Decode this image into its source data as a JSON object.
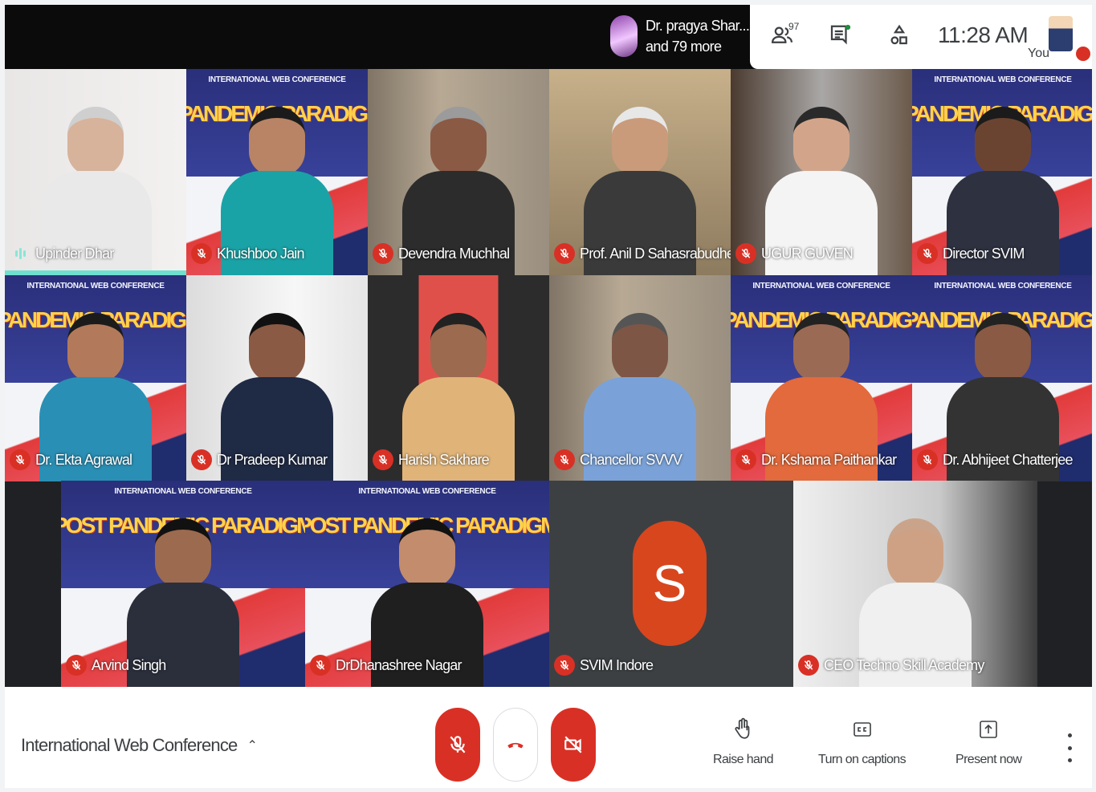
{
  "topbar": {
    "presenter_line1": "Dr. pragya Shar...",
    "presenter_line2": "and 79 more",
    "people_count": "97",
    "clock": "11:28 AM",
    "you_label": "You"
  },
  "tiles": [
    {
      "name": "Upinder Dhar",
      "state": "speaking",
      "icon": "audio-wave-icon"
    },
    {
      "name": "Khushboo Jain",
      "state": "muted",
      "icon": "mic-off-icon"
    },
    {
      "name": "Devendra Muchhal",
      "state": "muted",
      "icon": "mic-off-icon"
    },
    {
      "name": "Prof. Anil D Sahasrabudhe",
      "state": "muted",
      "icon": "mic-off-icon"
    },
    {
      "name": "UGUR GUVEN",
      "state": "muted",
      "icon": "mic-off-icon"
    },
    {
      "name": "Director SVIM",
      "state": "muted",
      "icon": "mic-off-icon"
    },
    {
      "name": "Dr. Ekta Agrawal",
      "state": "muted",
      "icon": "mic-off-icon"
    },
    {
      "name": "Dr Pradeep Kumar",
      "state": "muted",
      "icon": "mic-off-icon"
    },
    {
      "name": "Harish Sakhare",
      "state": "muted",
      "icon": "mic-off-icon"
    },
    {
      "name": "Chancellor SVVV",
      "state": "muted",
      "icon": "mic-off-icon"
    },
    {
      "name": "Dr. Kshama Paithankar",
      "state": "muted",
      "icon": "mic-off-icon"
    },
    {
      "name": "Dr. Abhijeet Chatterjee",
      "state": "muted",
      "icon": "mic-off-icon"
    },
    {
      "name": "Arvind Singh",
      "state": "muted",
      "icon": "mic-off-icon"
    },
    {
      "name": "DrDhanashree Nagar",
      "state": "muted",
      "icon": "mic-off-icon"
    },
    {
      "name": "SVIM Indore",
      "state": "muted",
      "icon": "mic-off-icon",
      "avatar_letter": "S"
    },
    {
      "name": "CEO Techno Skill Academy",
      "state": "muted",
      "icon": "mic-off-icon"
    }
  ],
  "banner": {
    "line1": "INTERNATIONAL WEB CONFERENCE",
    "line2": "PANDEMIC PARADIGM SHIFT IN HIGHER EDUCATION",
    "line3": "POST PANDEMIC PARADIGM SHIFT IN HIGHER EDUCATION"
  },
  "bottombar": {
    "meeting_title": "International Web Conference",
    "raise_hand": "Raise hand",
    "captions": "Turn on captions",
    "present": "Present now"
  },
  "colors": {
    "mute_red": "#d93025",
    "speaking_teal": "#6ee0cf",
    "avatar_orange": "#d8461e"
  }
}
